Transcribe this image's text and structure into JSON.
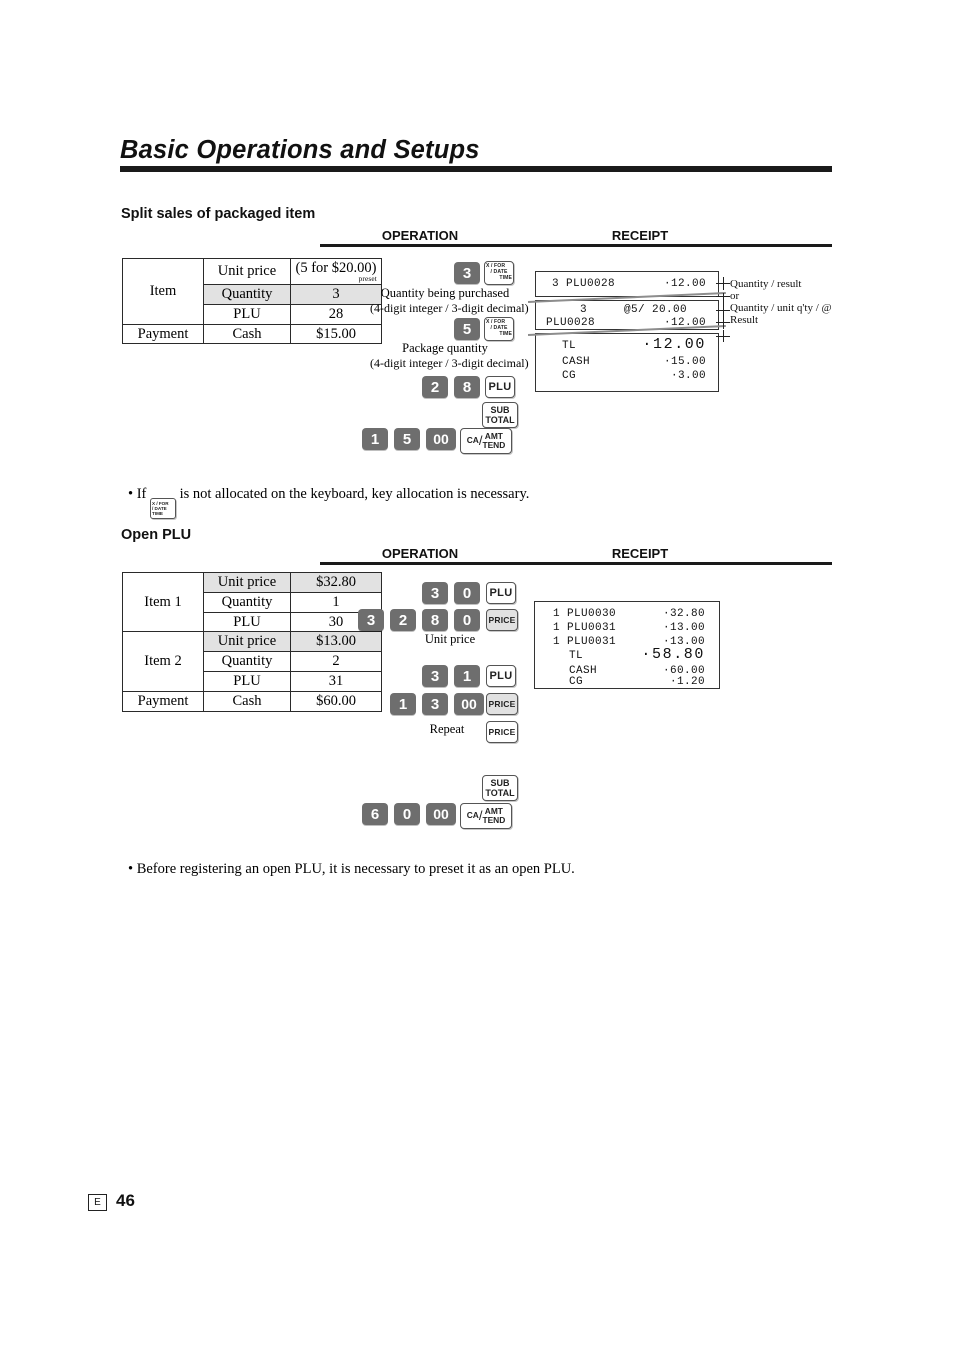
{
  "document": {
    "chapter_title": "Basic Operations and Setups",
    "page_number": "46",
    "language_code": "E"
  },
  "columns": {
    "operation": "OPERATION",
    "receipt": "RECEIPT"
  },
  "sections": [
    {
      "heading": "Split sales of packaged item",
      "table": {
        "rows": [
          {
            "label": "Item",
            "field": "Unit price",
            "value": "(5 for $20.00)",
            "sub": "preset",
            "shaded": false
          },
          {
            "label": "",
            "field": "Quantity",
            "value": "3",
            "shaded": true
          },
          {
            "label": "",
            "field": "PLU",
            "value": "28",
            "shaded": false
          },
          {
            "label": "Payment",
            "field": "Cash",
            "value": "$15.00",
            "shaded": false
          }
        ]
      },
      "operation": {
        "steps": [
          {
            "keys": [
              "3",
              "X/FOR DATE TIME"
            ],
            "caption": [
              "Quantity being purchased",
              "(4-digit integer / 3-digit decimal)"
            ]
          },
          {
            "keys": [
              "5",
              "X/FOR DATE TIME"
            ],
            "caption": [
              "Package quantity",
              "(4-digit integer / 3-digit decimal)"
            ]
          },
          {
            "keys": [
              "2",
              "8",
              "PLU"
            ],
            "caption": []
          },
          {
            "keys": [
              "SUB TOTAL"
            ],
            "caption": []
          },
          {
            "keys": [
              "1",
              "5",
              "00",
              "CA/AMT TEND"
            ],
            "caption": []
          }
        ],
        "key_labels": {
          "xfor_r1": "X / FOR",
          "xfor_r2": "/ DATE",
          "xfor_r3": "TIME",
          "plu": "PLU",
          "price": "PRICE",
          "sub_1": "SUB",
          "sub_2": "TOTAL",
          "ca_1": "CA",
          "ca_2": "AMT",
          "ca_3": "TEND"
        }
      },
      "receipt": {
        "panel_a": [
          {
            "left": "3 PLU0028",
            "right": "·12.00"
          }
        ],
        "panel_b": [
          {
            "left": "3",
            "mid": "@5/ 20.00",
            "right": ""
          },
          {
            "left": "PLU0028",
            "mid": "",
            "right": "·12.00"
          }
        ],
        "panel_c": [
          {
            "left": "TL",
            "right": "·12.00",
            "big": true
          },
          {
            "left": "CASH",
            "right": "·15.00",
            "big": false
          },
          {
            "left": "CG",
            "right": "·3.00",
            "big": false
          }
        ]
      },
      "annotations": [
        "Quantity / result",
        "or",
        "Quantity / unit q'ty / @",
        "Result"
      ]
    },
    {
      "heading": "Open PLU",
      "table": {
        "rows": [
          {
            "label": "Item 1",
            "field": "Unit price",
            "value": "$32.80",
            "shaded": true
          },
          {
            "label": "",
            "field": "Quantity",
            "value": "1",
            "shaded": false
          },
          {
            "label": "",
            "field": "PLU",
            "value": "30",
            "shaded": false
          },
          {
            "label": "Item 2",
            "field": "Unit price",
            "value": "$13.00",
            "shaded": true
          },
          {
            "label": "",
            "field": "Quantity",
            "value": "2",
            "shaded": false
          },
          {
            "label": "",
            "field": "PLU",
            "value": "31",
            "shaded": false
          },
          {
            "label": "Payment",
            "field": "Cash",
            "value": "$60.00",
            "shaded": false
          }
        ]
      },
      "operation": {
        "steps": [
          {
            "keys": [
              "3",
              "0",
              "PLU"
            ],
            "caption": []
          },
          {
            "keys": [
              "3",
              "2",
              "8",
              "0",
              "PRICE"
            ],
            "caption": [
              "Unit price"
            ]
          },
          {
            "keys": [
              "3",
              "1",
              "PLU"
            ],
            "caption": []
          },
          {
            "keys": [
              "1",
              "3",
              "00",
              "PRICE"
            ],
            "caption": []
          },
          {
            "keys": [
              "PRICE"
            ],
            "caption": [
              "Repeat"
            ]
          },
          {
            "keys": [
              "SUB TOTAL"
            ],
            "caption": []
          },
          {
            "keys": [
              "6",
              "0",
              "00",
              "CA/AMT TEND"
            ],
            "caption": []
          }
        ]
      },
      "receipt": {
        "lines": [
          {
            "left": "1 PLU0030",
            "right": "·32.80",
            "big": false
          },
          {
            "left": "1 PLU0031",
            "right": "·13.00",
            "big": false
          },
          {
            "left": "1 PLU0031",
            "right": "·13.00",
            "big": false
          },
          {
            "left": "TL",
            "right": "·58.80",
            "big": true
          },
          {
            "left": "CASH",
            "right": "·60.00",
            "big": false
          },
          {
            "left": "CG",
            "right": "·1.20",
            "big": false
          }
        ]
      }
    }
  ],
  "notes": {
    "note1_pre": "• If",
    "note1_post": "is not allocated on the keyboard, key allocation is necessary.",
    "note2": "• Before registering an open PLU, it is necessary to preset it as an open PLU."
  },
  "keypad_digits": {
    "d3": "3",
    "d5": "5",
    "d2": "2",
    "d8": "8",
    "d1": "1",
    "d0": "0",
    "d00": "00",
    "d6": "6"
  }
}
